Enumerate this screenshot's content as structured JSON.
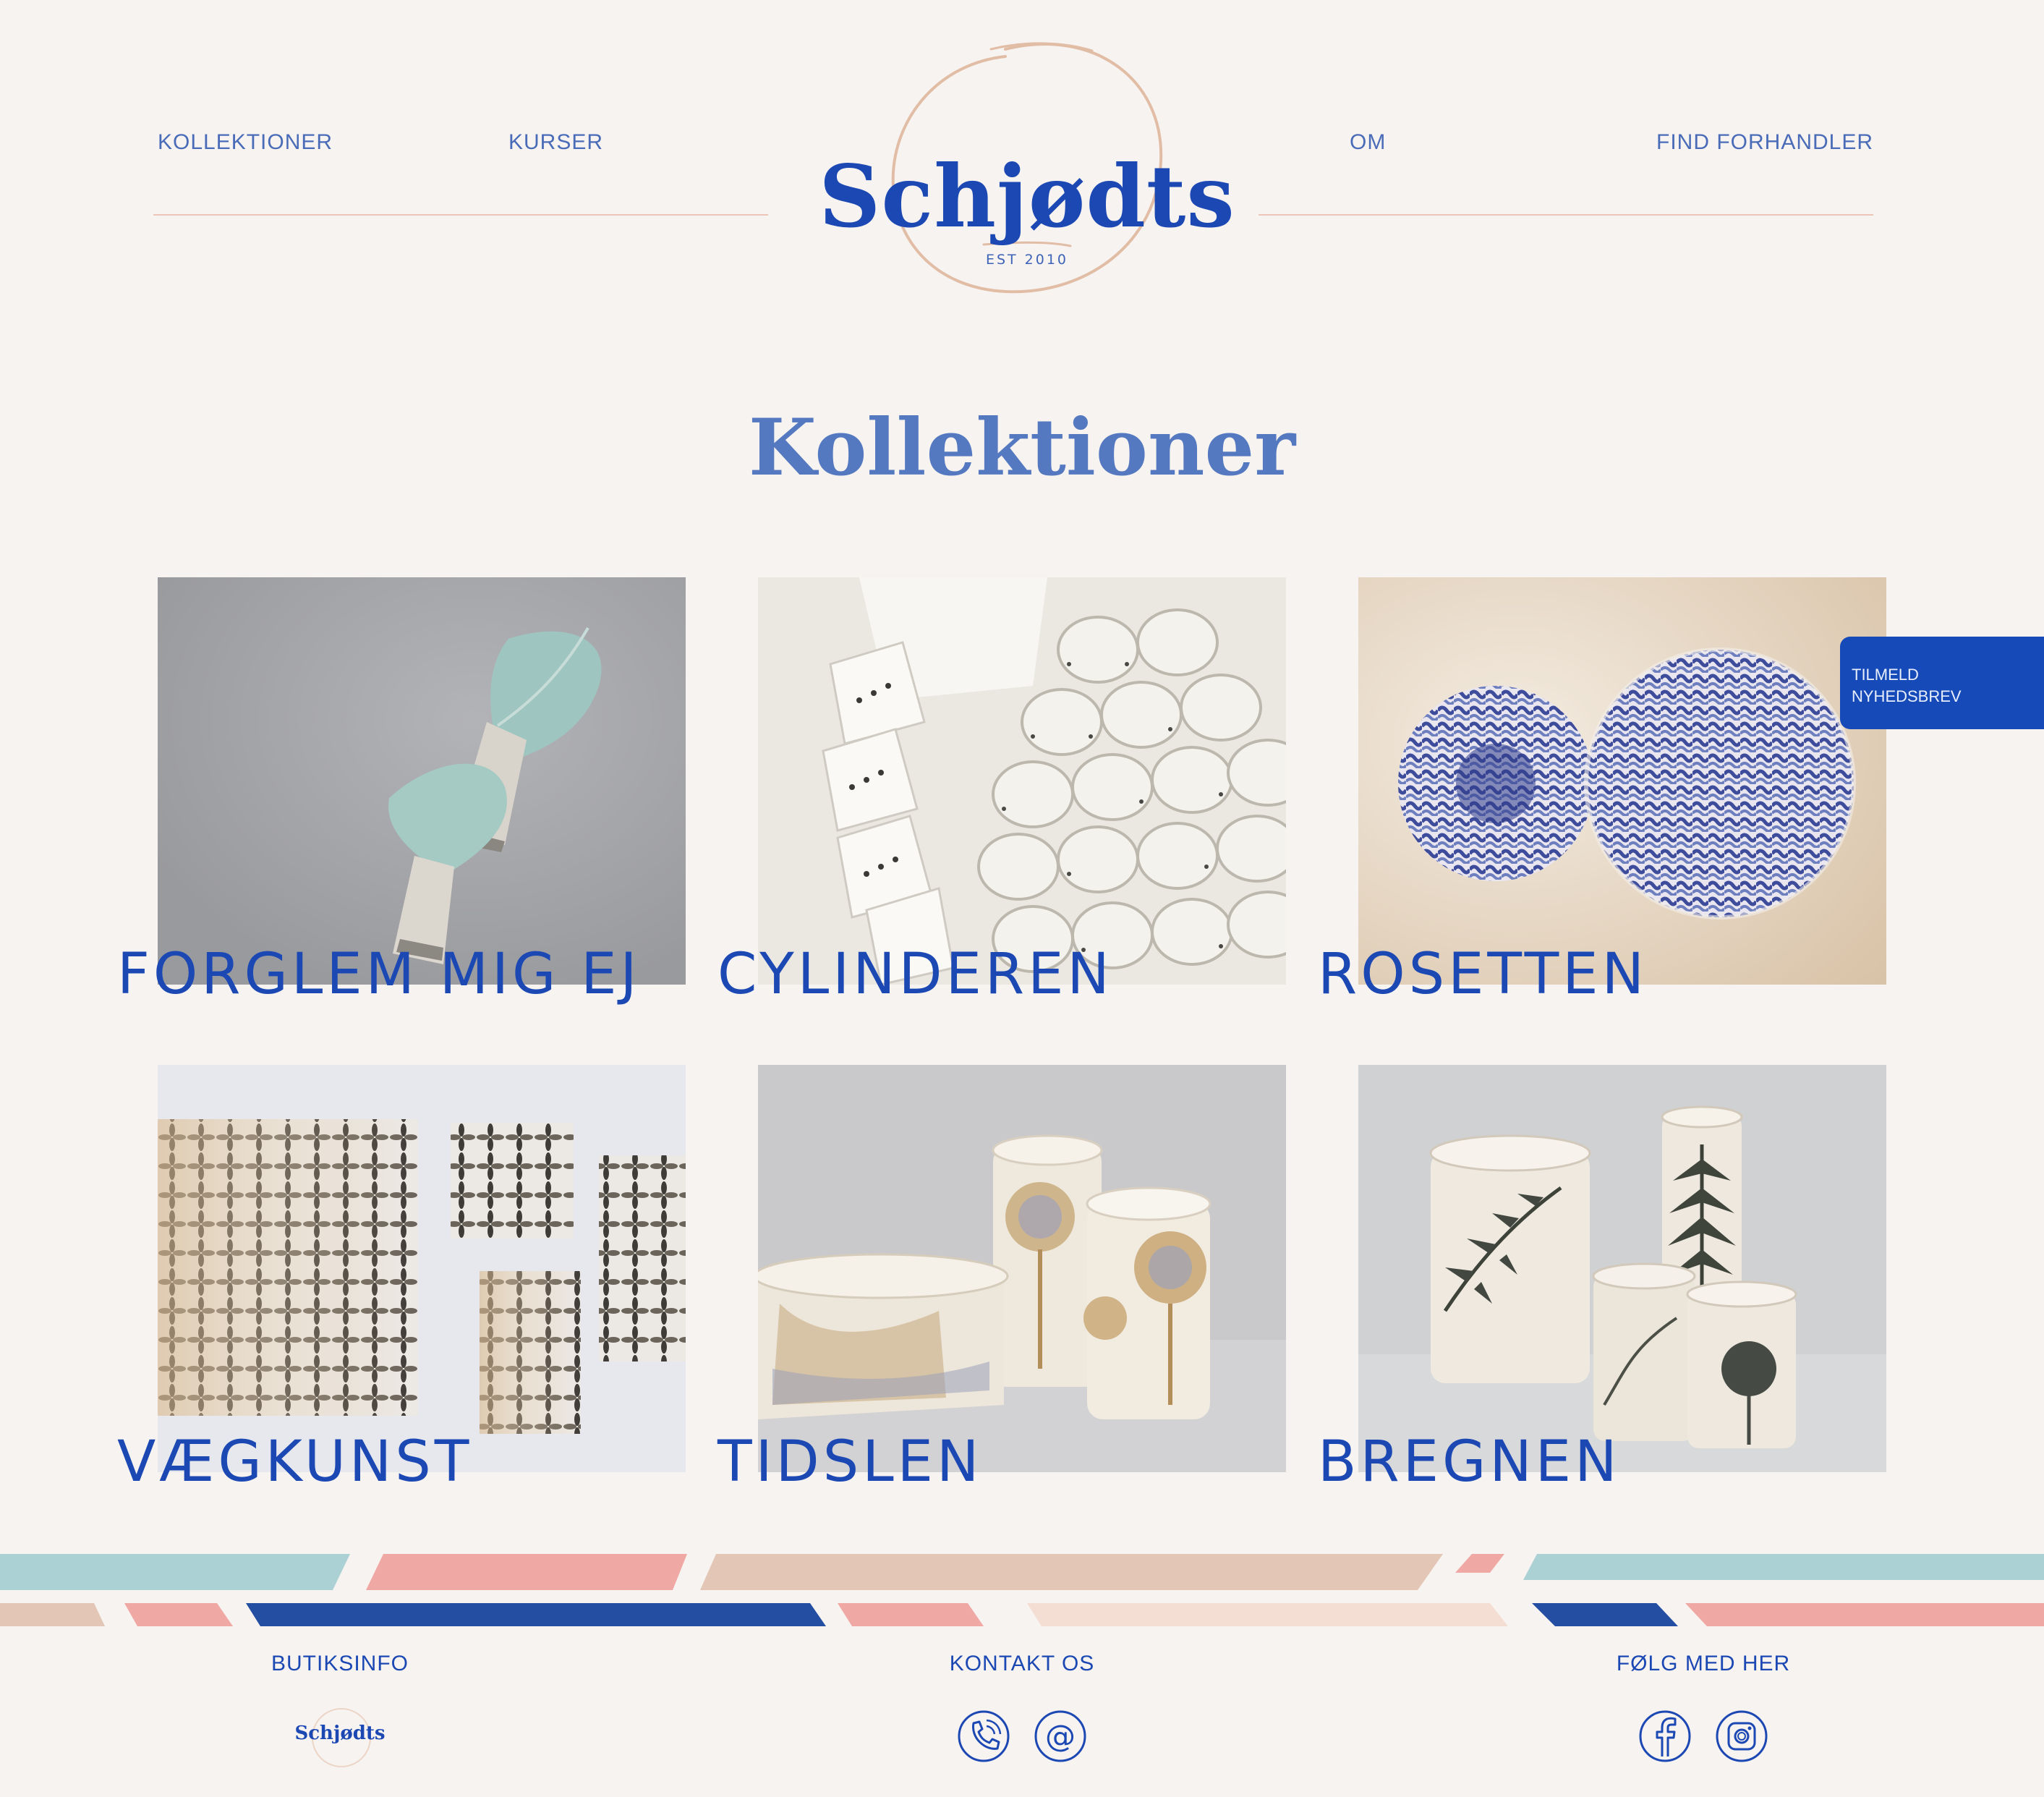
{
  "nav": {
    "left": [
      "KOLLEKTIONER",
      "KURSER"
    ],
    "right": [
      "OM",
      "FIND FORHANDLER"
    ]
  },
  "logo": {
    "name": "Schjødts",
    "est": "EST 2010"
  },
  "page_title": "Kollektioner",
  "collections": [
    {
      "label": "FORGLEM MIG EJ"
    },
    {
      "label": "CYLINDEREN"
    },
    {
      "label": "ROSETTEN"
    },
    {
      "label": "VÆGKUNST"
    },
    {
      "label": "TIDSLEN"
    },
    {
      "label": "BREGNEN"
    }
  ],
  "newsletter": {
    "line1": "TILMELD",
    "line2": "NYHEDSBREV"
  },
  "footer": {
    "shop_info": "BUTIKSINFO",
    "contact": "KONTAKT OS",
    "follow": "FØLG MED HER",
    "logo_text": "Schjødts"
  },
  "icons": {
    "contact": [
      "phone-icon",
      "email-at-icon"
    ],
    "social": [
      "facebook-icon",
      "instagram-icon"
    ]
  },
  "colors": {
    "background": "#f7f3f0",
    "brand_blue": "#1c48b4",
    "accent_pink": "#f0a8a4",
    "accent_teal": "#acd1d5",
    "accent_sand": "#e3c6b6"
  }
}
